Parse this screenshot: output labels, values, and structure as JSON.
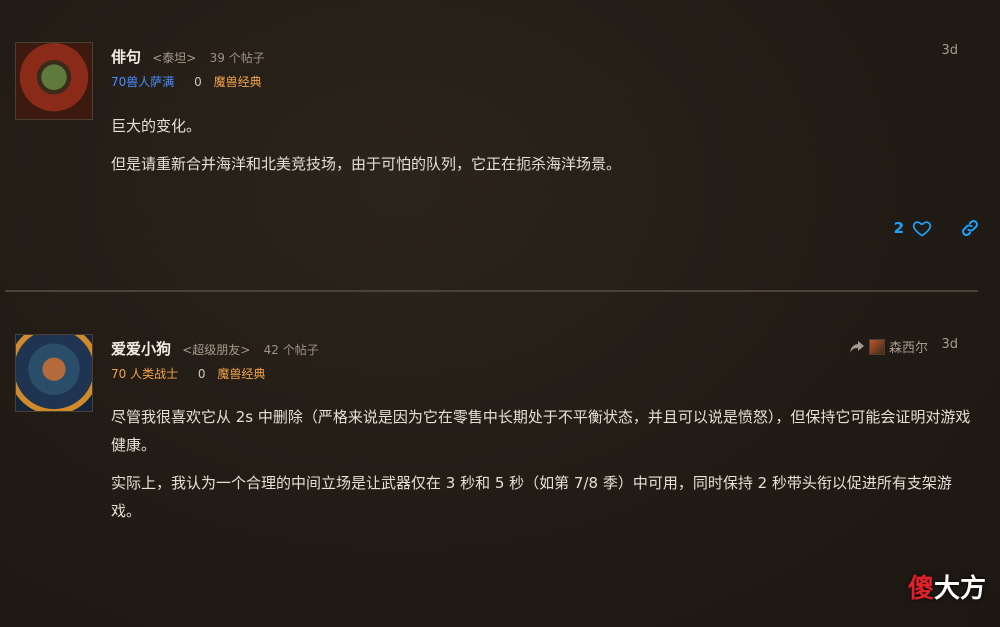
{
  "posts": [
    {
      "author": "俳句",
      "server_tag": "<泰坦>",
      "post_count": "39 个帖子",
      "class_label": "70兽人萨满",
      "zero": "0",
      "game": "魔兽经典",
      "date": "3d",
      "paragraphs": [
        "巨大的变化。",
        "但是请重新合并海洋和北美竞技场，由于可怕的队列，它正在扼杀海洋场景。"
      ],
      "likes": "2"
    },
    {
      "author": "爱爱小狗",
      "server_tag": "<超级朋友>",
      "post_count": "42 个帖子",
      "class_label": "70 人类战士",
      "zero": "0",
      "game": "魔兽经典",
      "reply_to": "森西尔",
      "date": "3d",
      "paragraphs": [
        "尽管我很喜欢它从 2s 中删除（严格来说是因为它在零售中长期处于不平衡状态，并且可以说是愤怒），但保持它可能会证明对游戏健康。",
        "实际上，我认为一个合理的中间立场是让武器仅在 3 秒和 5 秒（如第 7/8 季）中可用，同时保持 2 秒带头衔以促进所有支架游戏。"
      ]
    }
  ],
  "watermark": {
    "first": "傻",
    "rest": "大方"
  },
  "colors": {
    "accent_blue": "#1aa3ff",
    "class_orange": "#f0a24a",
    "class_blue": "#4a8cff"
  }
}
